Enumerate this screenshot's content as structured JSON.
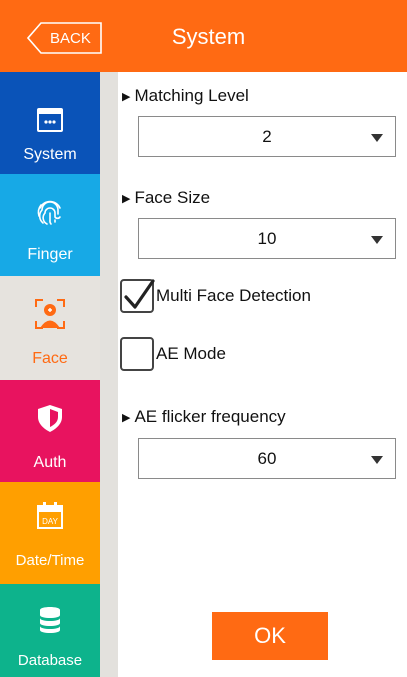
{
  "header": {
    "back_label": "BACK",
    "title": "System",
    "color": "#ff6a13"
  },
  "sidebar": {
    "items": [
      {
        "label": "System",
        "icon": "window-icon",
        "color": "#0a53b8",
        "selected": false
      },
      {
        "label": "Finger",
        "icon": "fingerprint-icon",
        "color": "#17a9e6",
        "selected": false
      },
      {
        "label": "Face",
        "icon": "face-icon",
        "color": "#e6e3de",
        "selected": true
      },
      {
        "label": "Auth",
        "icon": "shield-icon",
        "color": "#e8135f",
        "selected": false
      },
      {
        "label": "Date/Time",
        "icon": "calendar-icon",
        "color": "#ff9f00",
        "selected": false
      },
      {
        "label": "Database",
        "icon": "database-icon",
        "color": "#0db38c",
        "selected": false
      }
    ]
  },
  "main": {
    "matching_level": {
      "label": "Matching Level",
      "value": "2"
    },
    "face_size": {
      "label": "Face Size",
      "value": "10"
    },
    "multi_face": {
      "label": "Multi Face Detection",
      "checked": true
    },
    "ae_mode": {
      "label": "AE Mode",
      "checked": false
    },
    "ae_flicker": {
      "label": "AE flicker frequency",
      "value": "60"
    },
    "ok_label": "OK",
    "calendar_day": "DAY"
  }
}
